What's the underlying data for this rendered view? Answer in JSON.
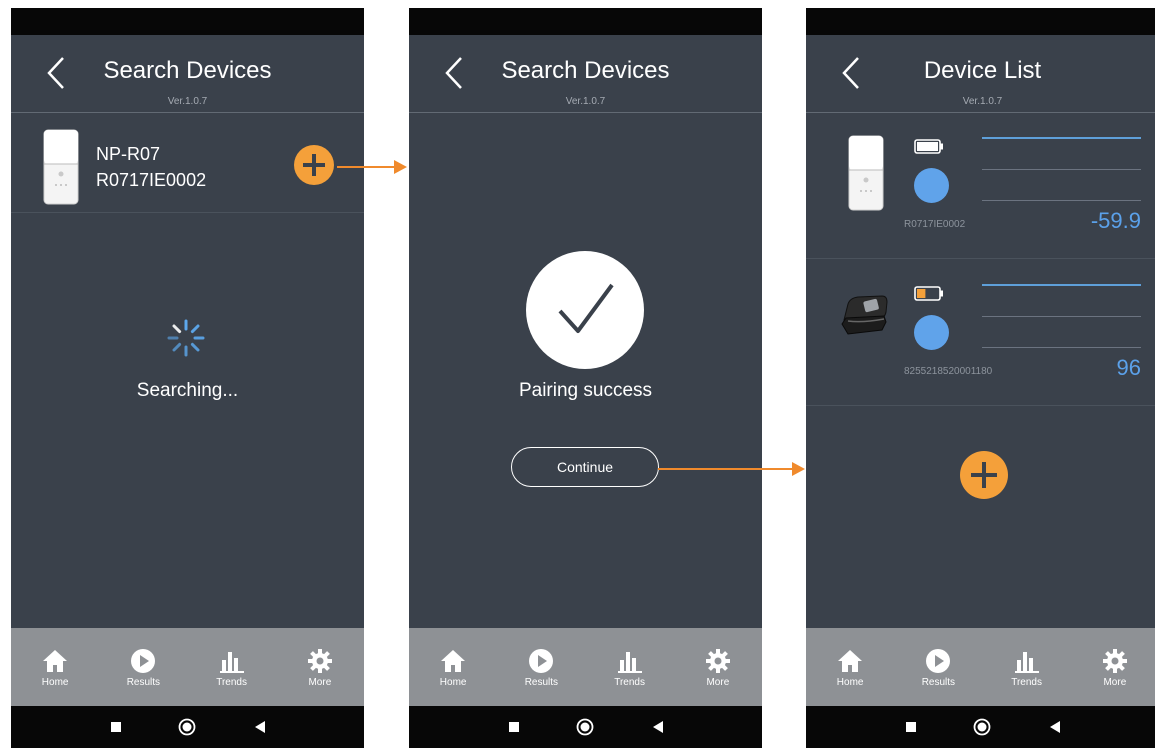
{
  "screens": [
    {
      "header": {
        "title": "Search Devices",
        "version": "Ver.1.0.7"
      },
      "device": {
        "name": "NP-R07",
        "serial": "R0717IE0002"
      },
      "status_text": "Searching..."
    },
    {
      "header": {
        "title": "Search Devices",
        "version": "Ver.1.0.7"
      },
      "status_text": "Pairing success",
      "continue_label": "Continue"
    },
    {
      "header": {
        "title": "Device List",
        "version": "Ver.1.0.7"
      },
      "devices": [
        {
          "serial": "R0717IE0002",
          "value": "-59.9",
          "battery_level": 1.0,
          "battery_color": "#ffffff"
        },
        {
          "serial": "8255218520001180",
          "value": "96",
          "battery_level": 0.4,
          "battery_color": "#f4a03a"
        }
      ]
    }
  ],
  "nav": [
    {
      "label": "Home",
      "icon": "home-icon"
    },
    {
      "label": "Results",
      "icon": "play-circle-icon"
    },
    {
      "label": "Trends",
      "icon": "bar-chart-icon"
    },
    {
      "label": "More",
      "icon": "gear-icon"
    }
  ],
  "colors": {
    "background": "#3a414b",
    "accent": "#f4a03a",
    "value_blue": "#5ba1ea",
    "nav_bar": "#8e9195",
    "arrow": "#f08a2c"
  }
}
